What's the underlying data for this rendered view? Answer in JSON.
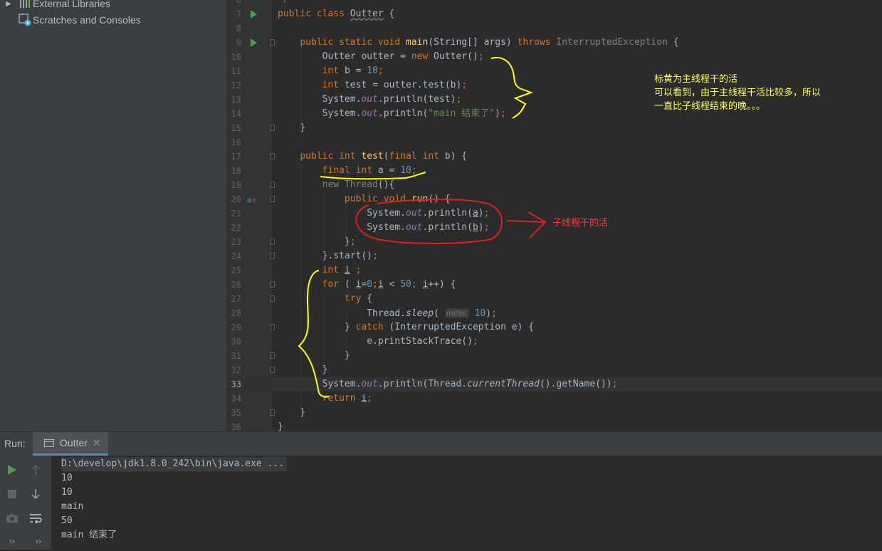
{
  "project_tree": {
    "items": [
      {
        "label": "External Libraries",
        "icon": "library-icon"
      },
      {
        "label": "Scratches and Consoles",
        "icon": "scratches-icon"
      }
    ]
  },
  "editor": {
    "current_line": 33,
    "lines": [
      {
        "n": 6,
        "code": ""
      },
      {
        "n": 7,
        "code": "public class Outter {"
      },
      {
        "n": 8,
        "code": ""
      },
      {
        "n": 9,
        "code": "public static void main(String[] args) throws InterruptedException {"
      },
      {
        "n": 10,
        "code": "Outter outter = new Outter();"
      },
      {
        "n": 11,
        "code": "int b = 10;"
      },
      {
        "n": 12,
        "code": "int test = outter.test(b);"
      },
      {
        "n": 13,
        "code": "System.out.println(test);"
      },
      {
        "n": 14,
        "code": "System.out.println(\"main 结束了\");"
      },
      {
        "n": 15,
        "code": "}"
      },
      {
        "n": 16,
        "code": ""
      },
      {
        "n": 17,
        "code": "public int test(final int b) {"
      },
      {
        "n": 18,
        "code": "final int a = 10;"
      },
      {
        "n": 19,
        "code": "new Thread(){"
      },
      {
        "n": 20,
        "code": "public void run() {"
      },
      {
        "n": 21,
        "code": "System.out.println(a);"
      },
      {
        "n": 22,
        "code": "System.out.println(b);"
      },
      {
        "n": 23,
        "code": "};"
      },
      {
        "n": 24,
        "code": "}.start();"
      },
      {
        "n": 25,
        "code": "int i ;"
      },
      {
        "n": 26,
        "code": "for ( i=0;i < 50; i++) {"
      },
      {
        "n": 27,
        "code": "try {"
      },
      {
        "n": 28,
        "code": "Thread.sleep( millis: 10);"
      },
      {
        "n": 29,
        "code": "} catch (InterruptedException e) {"
      },
      {
        "n": 30,
        "code": "e.printStackTrace();"
      },
      {
        "n": 31,
        "code": "}"
      },
      {
        "n": 32,
        "code": "}"
      },
      {
        "n": 33,
        "code": "System.out.println(Thread.currentThread().getName());"
      },
      {
        "n": 34,
        "code": "return i;"
      },
      {
        "n": 35,
        "code": "}"
      },
      {
        "n": 36,
        "code": "}"
      }
    ]
  },
  "annotations": {
    "main_thread_note_line1": "标黄为主线程干的活",
    "main_thread_note_line2": "可以看到，由于主线程干活比较多，所以",
    "main_thread_note_line3": "一直比子线程结束的晚。。。",
    "child_thread_note": "子线程干的活",
    "yellow": "#ffff00",
    "red": "#e02020"
  },
  "run_panel": {
    "label": "Run:",
    "tab_name": "Outter",
    "console": [
      "D:\\develop\\jdk1.8.0_242\\bin\\java.exe ...",
      "10",
      "10",
      "main",
      "50",
      "main 结束了"
    ]
  },
  "colors": {
    "keyword": "#cc7832",
    "method": "#ffc66d",
    "number": "#6897bb",
    "string": "#6a8759",
    "static_field": "#9876aa",
    "accent": "#4a88c7",
    "run_green": "#499c54"
  }
}
